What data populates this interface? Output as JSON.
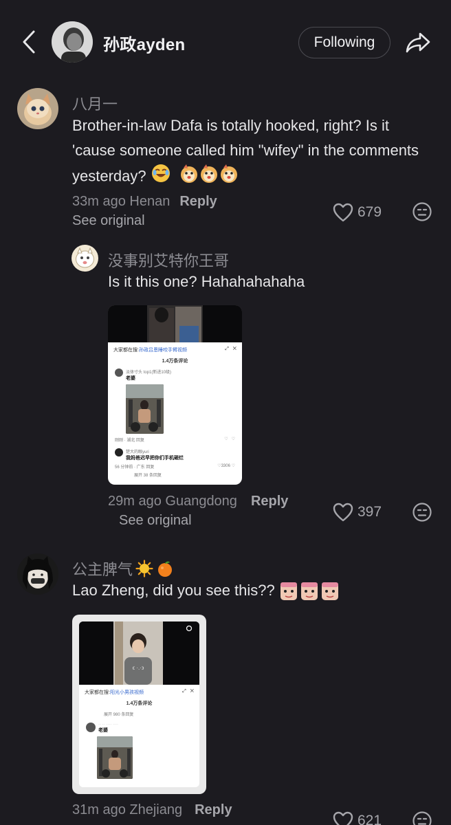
{
  "header": {
    "username": "孙政ayden",
    "follow_label": "Following"
  },
  "comments": [
    {
      "name": "八月一",
      "text": "Brother-in-law Dafa is totally hooked, right? Is it 'cause someone called him \"wifey\" in the comments yesterday?",
      "time_location": "33m ago Henan",
      "reply_label": "Reply",
      "see_original": "See original",
      "likes": "679"
    },
    {
      "name": "没事别艾特你王哥",
      "text": "Is it this one? Hahahahahaha",
      "time_location": "29m ago Guangdong",
      "reply_label": "Reply",
      "see_original": "See original",
      "likes": "397",
      "thumb": {
        "search_prefix": "大家都在搜:",
        "search_link": "孙政吕恩睡咬手臂视频",
        "count": "1.4万条评论",
        "c1_user": "淡体寸头 top1(新进10级)",
        "c1_text": "老婆",
        "c1_meta": "刚刚 · 湖北    回复",
        "c2_user": "楚大的眼yuri",
        "c2_text": "我妈爸迟早把你们手机砸烂",
        "c2_meta": "56 分钟前 · 广东    回复",
        "c2_likes": "3306",
        "expand": "展开 38 条回复"
      }
    },
    {
      "name": "公主脾气",
      "text": "Lao Zheng, did you see this??",
      "time_location": "31m ago Zhejiang",
      "reply_label": "Reply",
      "likes": "621",
      "thumb": {
        "search_prefix": "大家都在搜:",
        "search_link": "阳光小男孩视频",
        "count": "1.4万条评论",
        "expand": "展开 980 条回复",
        "c1_text": "老婆"
      }
    }
  ]
}
